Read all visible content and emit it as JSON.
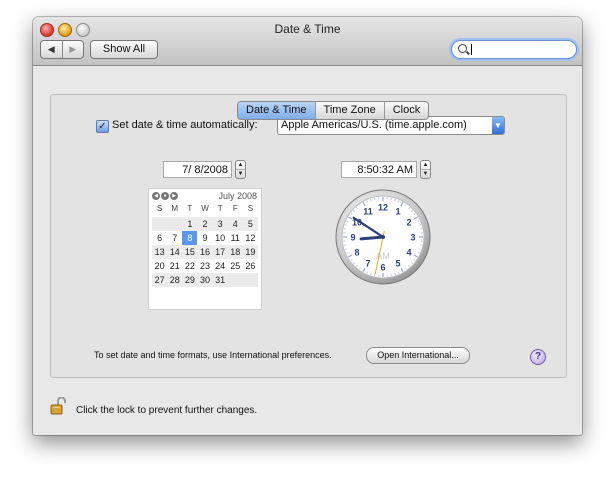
{
  "window": {
    "title": "Date & Time"
  },
  "toolbar": {
    "show_all": "Show All",
    "back": "◀",
    "forward": "▶"
  },
  "search": {
    "placeholder": ""
  },
  "tabs": [
    {
      "label": "Date & Time",
      "active": true
    },
    {
      "label": "Time Zone",
      "active": false
    },
    {
      "label": "Clock",
      "active": false
    }
  ],
  "auto": {
    "label": "Set date & time automatically:",
    "checked": true,
    "server": "Apple Americas/U.S. (time.apple.com)"
  },
  "date": {
    "value": "7/ 8/2008"
  },
  "time": {
    "value": "8:50:32 AM"
  },
  "calendar": {
    "month": "July 2008",
    "dow": [
      "S",
      "M",
      "T",
      "W",
      "T",
      "F",
      "S"
    ],
    "rows": [
      [
        "",
        "",
        "1",
        "2",
        "3",
        "4",
        "5"
      ],
      [
        "6",
        "7",
        "8",
        "9",
        "10",
        "11",
        "12"
      ],
      [
        "13",
        "14",
        "15",
        "16",
        "17",
        "18",
        "19"
      ],
      [
        "20",
        "21",
        "22",
        "23",
        "24",
        "25",
        "26"
      ],
      [
        "27",
        "28",
        "29",
        "30",
        "31",
        "",
        ""
      ]
    ],
    "selected": "8"
  },
  "clock": {
    "numbers": [
      "12",
      "1",
      "2",
      "3",
      "4",
      "5",
      "6",
      "7",
      "8",
      "9",
      "10",
      "11"
    ],
    "meridiem": "AM",
    "hour": 8,
    "minute": 50,
    "second": 32
  },
  "international": {
    "text": "To set date and time formats, use International preferences.",
    "button": "Open International..."
  },
  "help": {
    "label": "?"
  },
  "lock": {
    "text": "Click the lock to prevent further changes."
  },
  "colors": {
    "accent": "#5a96f0",
    "tab_active": "#7eaee9",
    "second_hand": "#f5a623"
  }
}
